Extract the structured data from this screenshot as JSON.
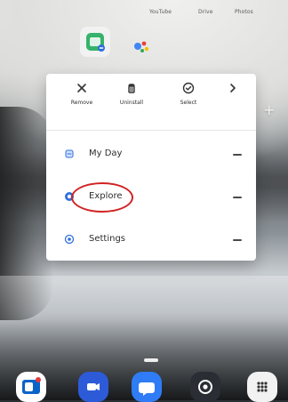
{
  "home": {
    "top_labels": [
      "YouTube",
      "Drive",
      "Photos"
    ],
    "popup_actions": [
      {
        "label": "Remove",
        "icon": "close-icon"
      },
      {
        "label": "Uninstall",
        "icon": "trash-icon"
      },
      {
        "label": "Select",
        "icon": "check-circle-icon"
      },
      {
        "label": "",
        "icon": "chevron-right-icon"
      }
    ],
    "shortcuts": [
      {
        "label": "My Day",
        "icon": "my-day-icon"
      },
      {
        "label": "Explore",
        "icon": "explore-icon"
      },
      {
        "label": "Settings",
        "icon": "settings-icon"
      }
    ],
    "colors": {
      "popup_bg": "#ffffff",
      "annotation": "#d22222",
      "accent_blue": "#2f6fdb"
    }
  }
}
